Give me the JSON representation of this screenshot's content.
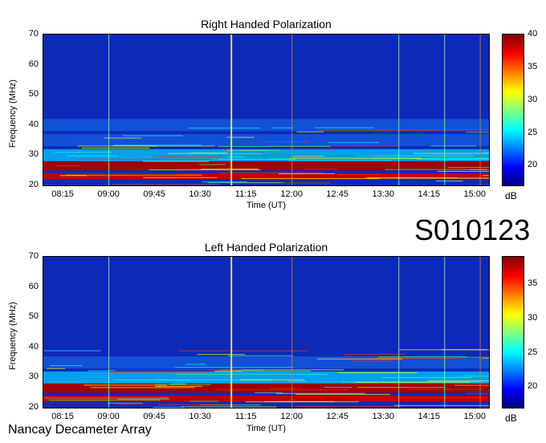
{
  "station_code": "S010123",
  "footer": "Nancay Decameter Array",
  "chart_data": [
    {
      "type": "heatmap",
      "title": "Right Handed Polarization",
      "xlabel": "Time (UT)",
      "ylabel": "Frequency (MHz)",
      "x_ticks": [
        "08:15",
        "09:00",
        "09:45",
        "10:30",
        "11:15",
        "12:00",
        "12:45",
        "13:30",
        "14:15",
        "15:00"
      ],
      "y_ticks": [
        20,
        30,
        40,
        50,
        60,
        70
      ],
      "ylim": [
        20,
        70
      ],
      "colorbar": {
        "label": "dB",
        "range": [
          17,
          40
        ],
        "ticks": [
          20,
          25,
          30,
          35,
          40
        ]
      },
      "strong_bands_mhz": [
        [
          22,
          24
        ],
        [
          25,
          28
        ]
      ],
      "moderate_bands_mhz": [
        [
          28,
          32
        ],
        [
          33,
          37
        ],
        [
          38,
          42
        ]
      ],
      "vertical_lines_ut": [
        "09:00",
        "11:00",
        "12:00",
        "13:45",
        "14:30",
        "15:05"
      ],
      "colormap": [
        "#00007f",
        "#0000ff",
        "#00ffff",
        "#ffff00",
        "#ff0000",
        "#7f0000"
      ]
    },
    {
      "type": "heatmap",
      "title": "Left Handed Polarization",
      "xlabel": "Time (UT)",
      "ylabel": "Frequency (MHz)",
      "x_ticks": [
        "08:15",
        "09:00",
        "09:45",
        "10:30",
        "11:15",
        "12:00",
        "12:45",
        "13:30",
        "14:15",
        "15:00"
      ],
      "y_ticks": [
        20,
        30,
        40,
        50,
        60,
        70
      ],
      "ylim": [
        20,
        70
      ],
      "colorbar": {
        "label": "dB",
        "range": [
          17,
          39
        ],
        "ticks": [
          20,
          25,
          30,
          35
        ]
      },
      "strong_bands_mhz": [
        [
          22,
          24
        ],
        [
          25,
          28
        ]
      ],
      "moderate_bands_mhz": [
        [
          28,
          32
        ],
        [
          33,
          37
        ]
      ],
      "vertical_lines_ut": [
        "09:00",
        "11:00",
        "12:00",
        "13:45",
        "14:30",
        "15:05"
      ],
      "colormap": [
        "#00007f",
        "#0000ff",
        "#00ffff",
        "#ffff00",
        "#ff0000",
        "#7f0000"
      ]
    }
  ]
}
